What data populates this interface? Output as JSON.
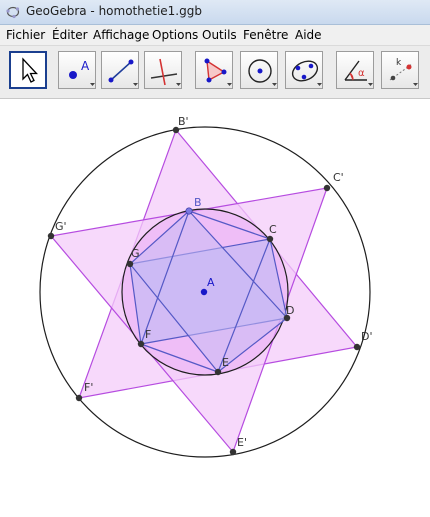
{
  "window": {
    "title": "GeoGebra - homothetie1.ggb"
  },
  "menu": {
    "items": [
      "Fichier",
      "Éditer",
      "Affichage",
      "Options",
      "Outils",
      "Fenêtre",
      "Aide"
    ]
  },
  "toolbar": {
    "tools": [
      {
        "name": "move-tool-icon",
        "selected": true
      },
      {
        "name": "point-tool-icon",
        "label": "A"
      },
      {
        "name": "line-tool-icon"
      },
      {
        "name": "perpendicular-tool-icon"
      },
      {
        "name": "polygon-tool-icon"
      },
      {
        "name": "circle-tool-icon"
      },
      {
        "name": "conic-tool-icon"
      },
      {
        "name": "angle-tool-icon"
      },
      {
        "name": "slider-tool-icon"
      }
    ]
  },
  "graphics": {
    "points": [
      {
        "name": "A",
        "label": "A"
      },
      {
        "name": "B",
        "label": "B"
      },
      {
        "name": "C",
        "label": "C"
      },
      {
        "name": "D",
        "label": "D"
      },
      {
        "name": "E",
        "label": "E"
      },
      {
        "name": "F",
        "label": "F"
      },
      {
        "name": "G",
        "label": "G"
      },
      {
        "name": "B-prime",
        "label": "B'"
      },
      {
        "name": "C-prime",
        "label": "C'"
      },
      {
        "name": "D-prime",
        "label": "D'"
      },
      {
        "name": "E-prime",
        "label": "E'"
      },
      {
        "name": "F-prime",
        "label": "F'"
      },
      {
        "name": "G-prime",
        "label": "G'"
      }
    ],
    "colors": {
      "fill": "#f4ccf9",
      "stroke_magenta": "#b64ce0",
      "stroke_blue": "#5559c6",
      "inner_fill": "#c6b9f4",
      "point_blue": "#1818c8",
      "point_dark": "#333333"
    }
  }
}
